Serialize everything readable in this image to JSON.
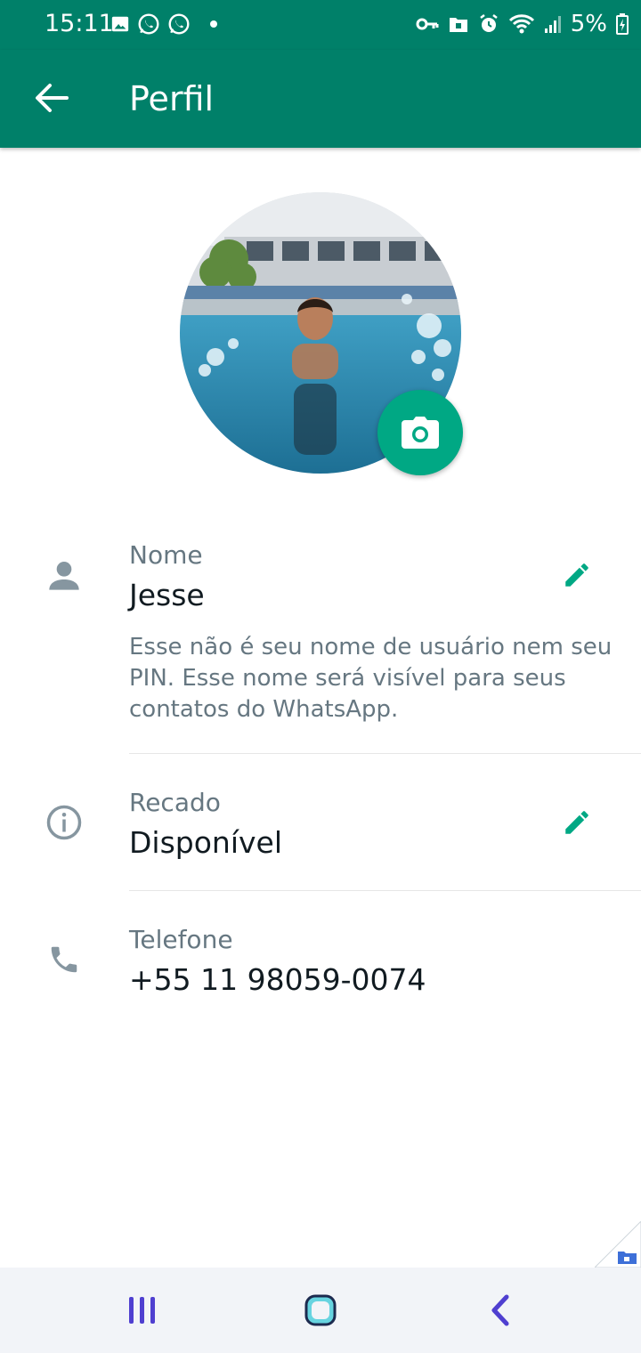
{
  "status_bar": {
    "time": "15:11",
    "battery": "5%",
    "left_icons": [
      "image-icon",
      "whatsapp-icon",
      "whatsapp-icon",
      "dot"
    ],
    "right_icons": [
      "vpn-key-icon",
      "secure-folder-icon",
      "alarm-icon",
      "wifi-icon",
      "signal-icon",
      "battery-charging-icon"
    ]
  },
  "app_bar": {
    "title": "Perfil",
    "back_icon": "arrow-back-icon"
  },
  "profile": {
    "camera_icon": "camera-icon"
  },
  "name_row": {
    "icon": "person-icon",
    "label": "Nome",
    "value": "Jesse",
    "hint": "Esse não é seu nome de usuário nem seu PIN. Esse nome será visível para seus contatos do WhatsApp.",
    "edit_icon": "pencil-icon"
  },
  "about_row": {
    "icon": "info-icon",
    "label": "Recado",
    "value": "Disponível",
    "edit_icon": "pencil-icon"
  },
  "phone_row": {
    "icon": "phone-icon",
    "label": "Telefone",
    "value": "+55 11 98059-0074"
  },
  "nav_bar": {
    "recents_icon": "recents-icon",
    "home_icon": "home-icon",
    "back_icon": "nav-back-icon"
  },
  "colors": {
    "primary": "#008069",
    "accent": "#00a884",
    "secondary_text": "#667781",
    "primary_text": "#111b21"
  }
}
